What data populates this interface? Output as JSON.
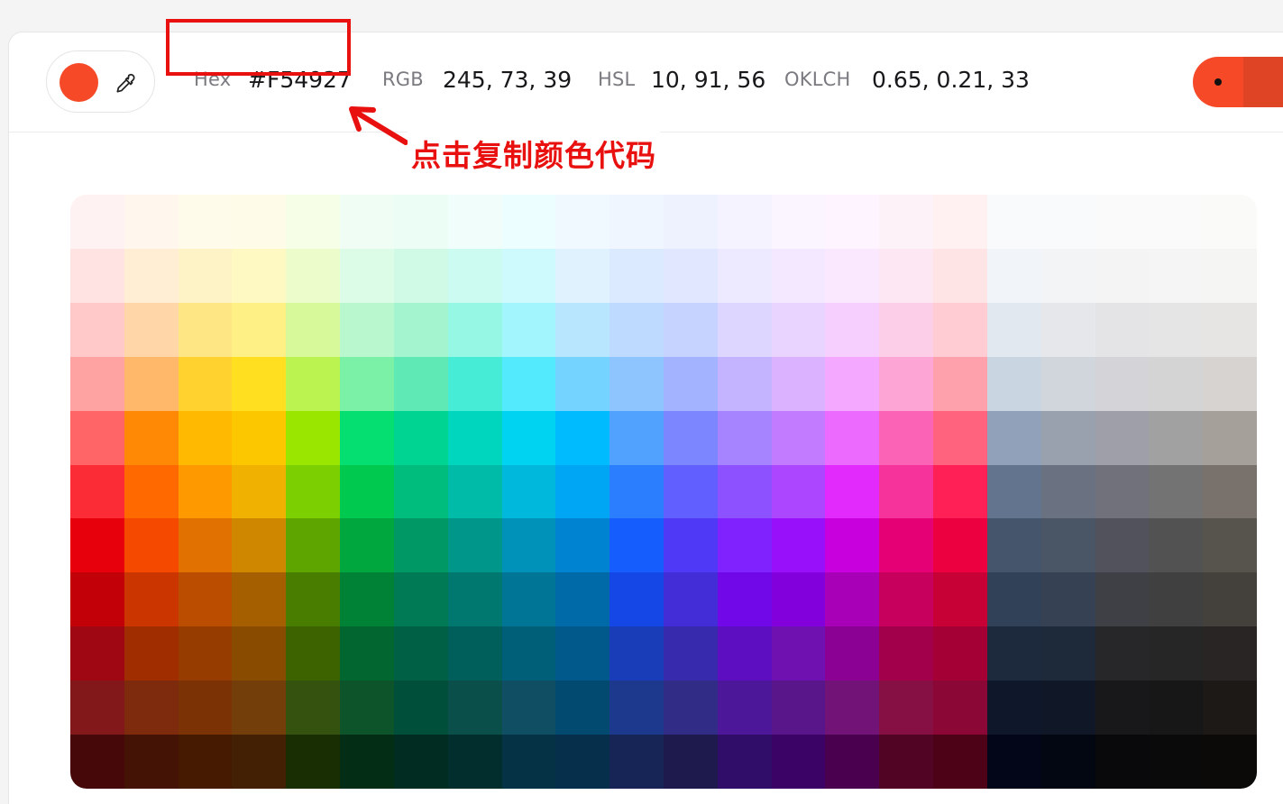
{
  "selected_color": {
    "swatch": "#F54927",
    "hex_label": "Hex",
    "hex_value": "#F54927",
    "rgb_label": "RGB",
    "rgb_value": "245, 73, 39",
    "hsl_label": "HSL",
    "hsl_value": "10, 91, 56",
    "oklch_label": "OKLCH",
    "oklch_value": "0.65, 0.21, 33"
  },
  "picker_icon": "eyedropper-icon",
  "annotation": {
    "text": "点击复制颜色代码",
    "color": "#E8110F"
  },
  "palette": {
    "rows": [
      [
        "#fef2f2",
        "#fff7ed",
        "#fffbeb",
        "#fefce8",
        "#f7fee7",
        "#f0fdf4",
        "#ecfdf5",
        "#f0fdfa",
        "#ecfeff",
        "#f0f9ff",
        "#eff6ff",
        "#eef2ff",
        "#f5f3ff",
        "#faf5ff",
        "#fdf4ff",
        "#fdf2f8",
        "#fff1f2",
        "#f8fafc",
        "#f9fafb",
        "#fafafa",
        "#fafafa",
        "#fafaf9"
      ],
      [
        "#ffe2e2",
        "#ffedd4",
        "#fef3c6",
        "#fef9c2",
        "#ecfcca",
        "#dcfce7",
        "#d0fae5",
        "#cbfbf1",
        "#cefafe",
        "#dff2fe",
        "#dbeafe",
        "#e0e7ff",
        "#ede9fe",
        "#f3e8ff",
        "#fae8ff",
        "#fce7f3",
        "#ffe4e6",
        "#f1f5f9",
        "#f3f4f6",
        "#f4f4f5",
        "#f5f5f5",
        "#f5f5f4"
      ],
      [
        "#ffc9c9",
        "#ffd6a7",
        "#fee685",
        "#fff085",
        "#d8f999",
        "#b9f8cf",
        "#a4f4cf",
        "#96f7e4",
        "#a2f4fd",
        "#b8e6fe",
        "#bedbff",
        "#c6d2ff",
        "#ddd6ff",
        "#e9d4ff",
        "#f6cfff",
        "#fccee8",
        "#ffccd3",
        "#e2e8f0",
        "#e5e7eb",
        "#e4e4e7",
        "#e5e5e5",
        "#e7e5e4"
      ],
      [
        "#ffa2a2",
        "#ffb86a",
        "#ffd230",
        "#ffdf20",
        "#bbf451",
        "#7bf1a8",
        "#5ee9b5",
        "#46ecd5",
        "#53eafd",
        "#74d4ff",
        "#8ec5ff",
        "#a3b3ff",
        "#c4b4ff",
        "#dab2ff",
        "#f4a8ff",
        "#fda5d5",
        "#ffa1ad",
        "#cad5e2",
        "#d1d5dc",
        "#d4d4d8",
        "#d4d4d4",
        "#d6d3d1"
      ],
      [
        "#ff6467",
        "#ff8904",
        "#ffb900",
        "#fdc700",
        "#9ae600",
        "#05df72",
        "#00d492",
        "#00d5be",
        "#00d3f2",
        "#00bcff",
        "#51a2ff",
        "#7c86ff",
        "#a684ff",
        "#c27aff",
        "#ed6aff",
        "#fb64b6",
        "#ff637e",
        "#90a1b9",
        "#99a1af",
        "#9f9fa9",
        "#a1a1a1",
        "#a6a09b"
      ],
      [
        "#fb2c36",
        "#ff6900",
        "#fe9a00",
        "#f0b100",
        "#7ccf00",
        "#00c950",
        "#00bc7d",
        "#00bba7",
        "#00b8db",
        "#00a6f4",
        "#2b7fff",
        "#615fff",
        "#8e51ff",
        "#ad46ff",
        "#e12afb",
        "#f6339a",
        "#ff2056",
        "#62748e",
        "#6a7282",
        "#71717b",
        "#737373",
        "#79716b"
      ],
      [
        "#e7000b",
        "#f54900",
        "#e17100",
        "#d08700",
        "#5ea500",
        "#00a63e",
        "#009966",
        "#009689",
        "#0092b8",
        "#0084d1",
        "#155dfc",
        "#4f39f6",
        "#7f22fe",
        "#9810fa",
        "#c800de",
        "#e60076",
        "#ec003f",
        "#45556c",
        "#4a5565",
        "#52525c",
        "#525252",
        "#57534d"
      ],
      [
        "#c10007",
        "#ca3500",
        "#bb4d00",
        "#a65f00",
        "#497d00",
        "#008236",
        "#007a55",
        "#00786f",
        "#007595",
        "#0069a8",
        "#1447e6",
        "#432dd7",
        "#7008e7",
        "#8200db",
        "#a800b7",
        "#c6005c",
        "#c70036",
        "#314158",
        "#364153",
        "#3f3f46",
        "#404040",
        "#44403b"
      ],
      [
        "#9f0712",
        "#9f2d00",
        "#973c00",
        "#894b00",
        "#3c6300",
        "#016630",
        "#006045",
        "#005f5a",
        "#005f78",
        "#00598a",
        "#193cb8",
        "#372aac",
        "#5d0ec0",
        "#6e11b0",
        "#8a0194",
        "#a3004c",
        "#a50036",
        "#1d293d",
        "#1e2939",
        "#27272a",
        "#262626",
        "#292524"
      ],
      [
        "#82181a",
        "#7e2a0c",
        "#7b3306",
        "#733e0a",
        "#35530e",
        "#0d542b",
        "#004f3b",
        "#0b4f4a",
        "#104e64",
        "#024a70",
        "#1c398e",
        "#312c85",
        "#4d179a",
        "#59168b",
        "#721378",
        "#861043",
        "#8b0836",
        "#0f172b",
        "#101828",
        "#18181b",
        "#171717",
        "#1c1917"
      ],
      [
        "#460809",
        "#441306",
        "#461901",
        "#432004",
        "#192e03",
        "#032e15",
        "#002c22",
        "#022f2e",
        "#053345",
        "#052f4a",
        "#162456",
        "#1e1a4d",
        "#2f0d68",
        "#3c0366",
        "#4b004f",
        "#510424",
        "#4d0218",
        "#020618",
        "#030712",
        "#09090b",
        "#0a0a0a",
        "#0c0a09"
      ]
    ]
  },
  "accent_button": {
    "color": "#F54927"
  }
}
